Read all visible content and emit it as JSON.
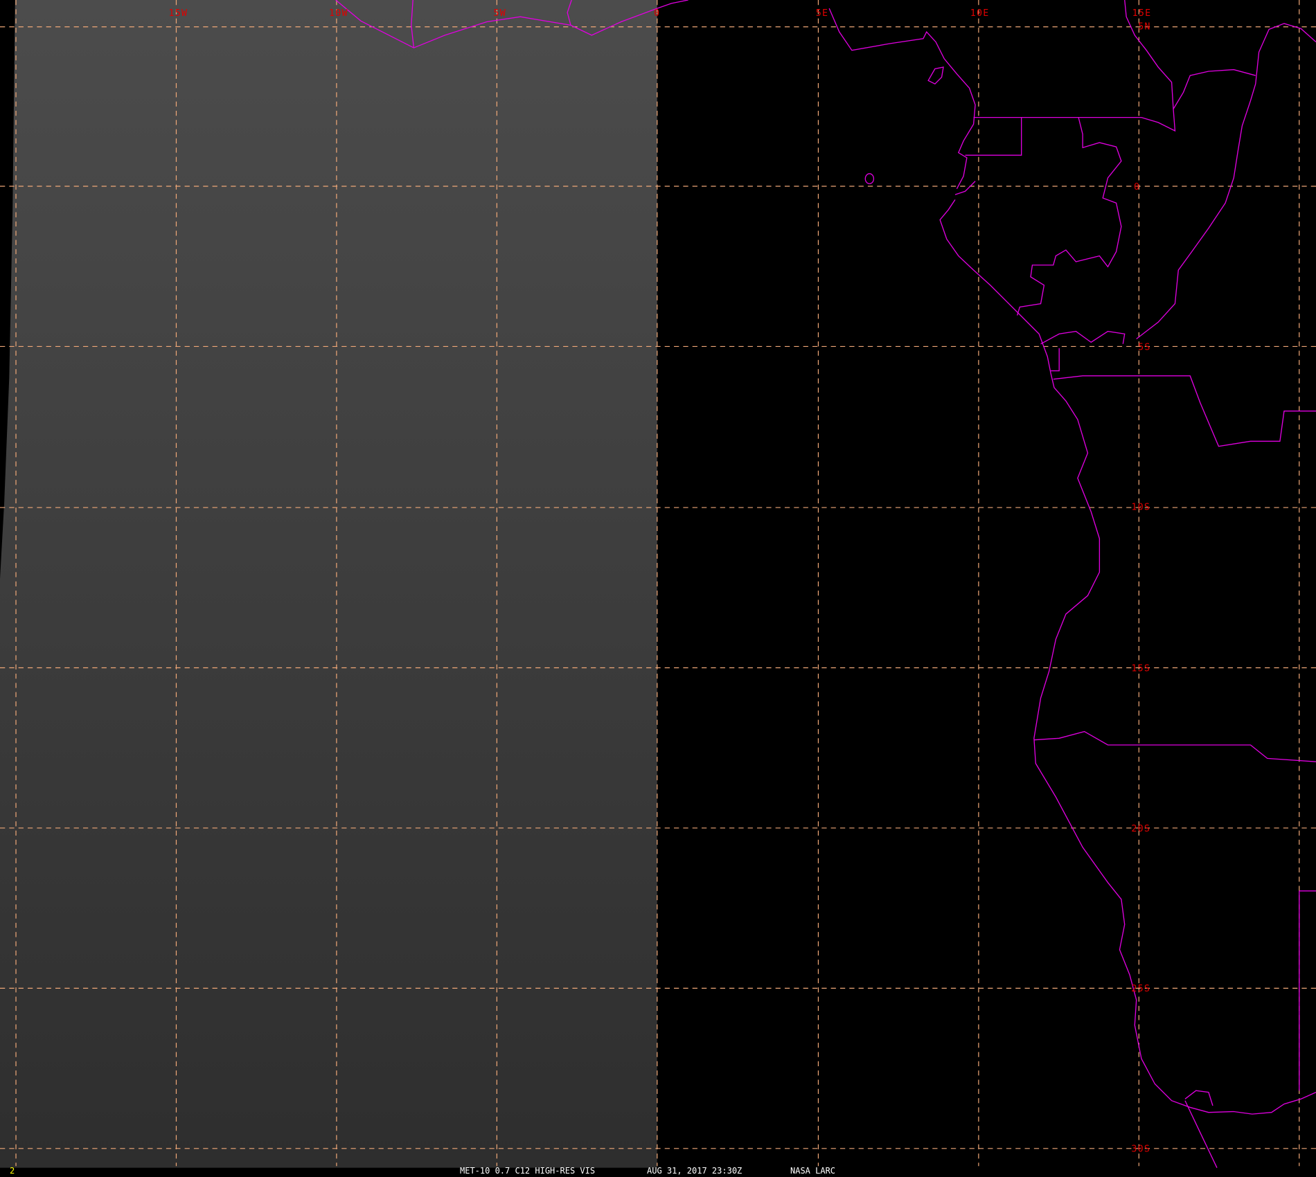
{
  "colors": {
    "grid": "#f0a878",
    "coastline": "#e000e0",
    "labels": "#e00000",
    "frame_number": "#ffff00"
  },
  "longitude_labels": [
    "15W",
    "10W",
    "5W",
    "0",
    "5E",
    "10E",
    "15E"
  ],
  "latitude_labels": [
    "5N",
    "0",
    "5S",
    "10S",
    "15S",
    "20S",
    "25S",
    "30S"
  ],
  "footer": {
    "frame_number": "2",
    "product": "MET-10 0.7 C12 HIGH-RES VIS",
    "datetime": "AUG 31, 2017 23:30Z",
    "source": "NASA LARC"
  }
}
